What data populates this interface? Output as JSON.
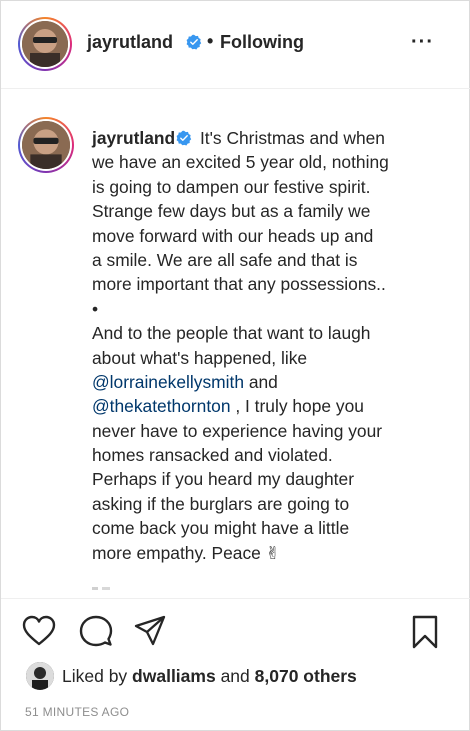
{
  "header": {
    "username": "jayrutland",
    "separator": "•",
    "following_label": "Following",
    "more_label": "···"
  },
  "caption": {
    "username": "jayrutland",
    "line1": " It's Christmas and when",
    "line2": "we have an excited 5 year old, nothing",
    "line3": "is going to dampen our festive spirit.",
    "line4": "Strange few days but as a family we",
    "line5": "move forward with our heads up and",
    "line6": "a smile. We are all safe and that is",
    "line7": "more important that any possessions..",
    "line8": "•",
    "line9": "And to the people that want to laugh",
    "line10": "about what's happened, like",
    "mention1": "@lorrainekellysmith",
    "line11_rest": " and",
    "mention2": "@thekatethornton",
    "line12_rest": " , I truly hope you",
    "line13": "never have to experience having your",
    "line14": "homes ransacked and violated.",
    "line15": "Perhaps if you heard my daughter",
    "line16": "asking if the burglars are going to",
    "line17": "come back you might have a little",
    "line18": "more empathy. Peace ✌"
  },
  "likes": {
    "prefix": "Liked by ",
    "user": "dwalliams",
    "middle": " and ",
    "count": "8,070 others"
  },
  "timestamp": "51 MINUTES AGO",
  "icons": {
    "verified": "verified-badge-icon",
    "like": "heart-icon",
    "comment": "comment-icon",
    "share": "paper-plane-icon",
    "save": "bookmark-icon"
  },
  "colors": {
    "verified": "#3897f0",
    "mention": "#00376b",
    "text": "#262626",
    "muted": "#8e8e8e"
  }
}
